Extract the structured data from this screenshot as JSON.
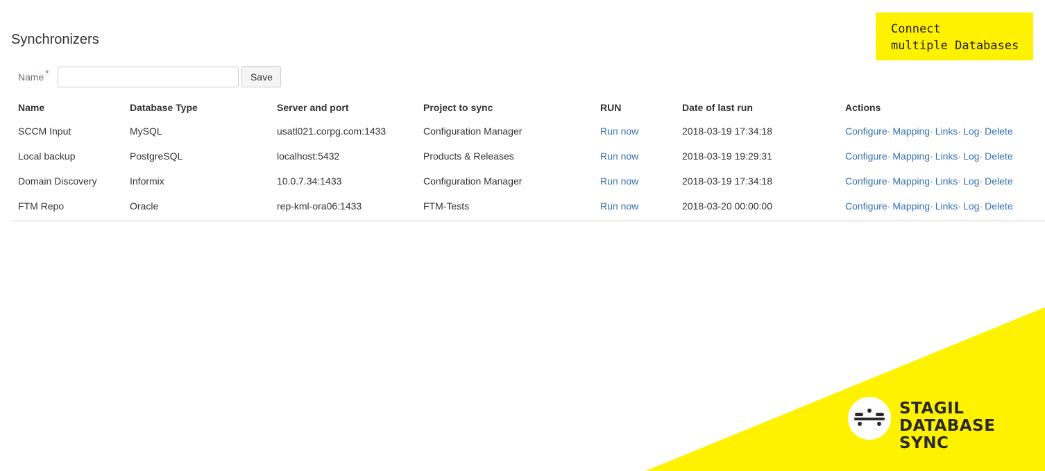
{
  "page": {
    "title": "Synchronizers"
  },
  "form": {
    "name_label": "Name",
    "required_mark": "*",
    "name_value": "",
    "name_placeholder": "",
    "save_label": "Save"
  },
  "table": {
    "headers": [
      "Name",
      "Database Type",
      "Server and port",
      "Project to sync",
      "RUN",
      "Date of last run",
      "Actions"
    ],
    "rows": [
      {
        "name": "SCCM Input",
        "db_type": "MySQL",
        "server": "usatl021.corpg.com:1433",
        "project": "Configuration Manager",
        "run": "Run now",
        "last_run": "2018-03-19 17:34:18"
      },
      {
        "name": "Local backup",
        "db_type": "PostgreSQL",
        "server": "localhost:5432",
        "project": "Products & Releases",
        "run": "Run now",
        "last_run": "2018-03-19 19:29:31"
      },
      {
        "name": "Domain Discovery",
        "db_type": "Informix",
        "server": "10.0.7.34:1433",
        "project": "Configuration Manager",
        "run": "Run now",
        "last_run": "2018-03-19 17:34:18"
      },
      {
        "name": "FTM Repo",
        "db_type": "Oracle",
        "server": "rep-kml-ora06:1433",
        "project": "FTM-Tests",
        "run": "Run now",
        "last_run": "2018-03-20 00:00:00"
      }
    ],
    "actions": {
      "configure": "Configure",
      "mapping": "Mapping",
      "links": "Links",
      "log": "Log",
      "delete": "Delete",
      "separator": "·"
    }
  },
  "promo": {
    "line1": "Connect",
    "line2": "multiple Databases"
  },
  "brand": {
    "line1": "STAGIL",
    "line2": "DATABASE",
    "line3": "SYNC",
    "logo_icon": "database-link-icon"
  },
  "colors": {
    "accent_yellow": "#fff200",
    "link_blue": "#3572b0",
    "required_red": "#d04437"
  }
}
